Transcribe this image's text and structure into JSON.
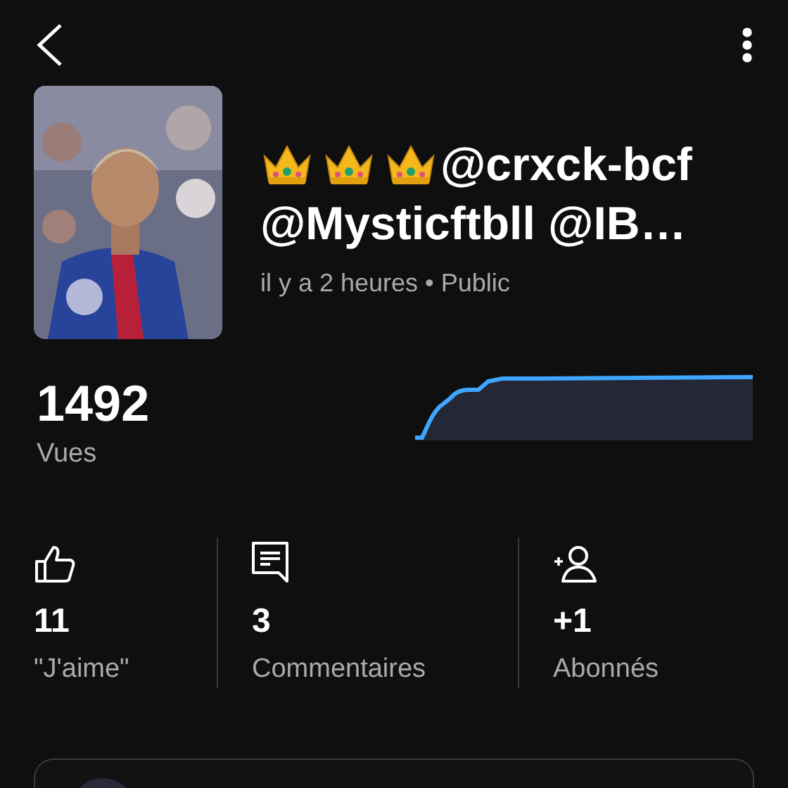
{
  "video": {
    "title_line_1": "@crxck-bcf",
    "title_line_2": "@Mysticftbll @IB…",
    "crowns": [
      {
        "kind": "crown"
      },
      {
        "kind": "crown"
      },
      {
        "kind": "crown"
      }
    ],
    "meta": "il y a 2 heures • Public"
  },
  "views": {
    "count": "1492",
    "label": "Vues"
  },
  "stats": [
    {
      "kind": "likes",
      "value": "11",
      "label": "\"J'aime\""
    },
    {
      "kind": "comments",
      "value": "3",
      "label": "Commentaires"
    },
    {
      "kind": "subscribers",
      "value": "+1",
      "label": "Abonnés"
    }
  ]
}
